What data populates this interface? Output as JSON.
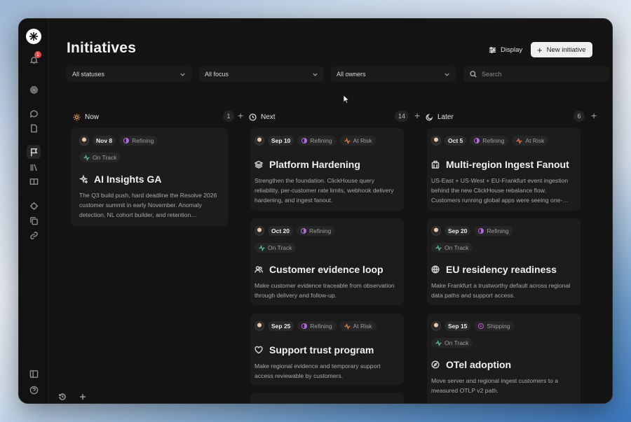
{
  "page": {
    "title": "Initiatives"
  },
  "toolbar": {
    "display_label": "Display",
    "new_label": "New initiative"
  },
  "notifications": {
    "count": "1"
  },
  "filters": {
    "status": "All statuses",
    "focus": "All focus",
    "owners": "All owners",
    "search_placeholder": "Search"
  },
  "columns": [
    {
      "name": "Now",
      "count": "1",
      "icon": "sun-icon"
    },
    {
      "name": "Next",
      "count": "14",
      "icon": "clock-icon"
    },
    {
      "name": "Later",
      "count": "6",
      "icon": "moon-icon"
    }
  ],
  "cards": {
    "now": [
      {
        "date": "Nov 8",
        "status": "Refining",
        "health": "On Track",
        "title": "AI Insights GA",
        "icon": "sparkles-icon",
        "desc": "The Q3 build push, hard deadline the Resolve 2026 customer summit in early November. Anomaly detection, NL cohort builder, and retention…"
      }
    ],
    "next": [
      {
        "date": "Sep 10",
        "status": "Refining",
        "risk": "At Risk",
        "title": "Platform Hardening",
        "icon": "layers-icon",
        "desc": "Strengthen the foundation. ClickHouse query reliability, per-customer rate limits, webhook delivery hardening, and ingest fanout."
      },
      {
        "date": "Oct 20",
        "status": "Refining",
        "health": "On Track",
        "title": "Customer evidence loop",
        "icon": "users-icon",
        "desc": "Make customer evidence traceable from observation through delivery and follow-up."
      },
      {
        "date": "Sep 25",
        "status": "Refining",
        "risk": "At Risk",
        "title": "Support trust program",
        "icon": "heart-icon",
        "desc": "Make regional evidence and temporary support access reviewable by customers."
      }
    ],
    "later": [
      {
        "date": "Oct 5",
        "status": "Refining",
        "risk": "At Risk",
        "title": "Multi-region Ingest Fanout",
        "icon": "building-icon",
        "desc": "US-East + US-West + EU-Frankfurt event ingestion behind the new ClickHouse rebalance flow. Customers running global apps were seeing one-…"
      },
      {
        "date": "Sep 20",
        "status": "Refining",
        "health": "On Track",
        "title": "EU residency readiness",
        "icon": "globe-icon",
        "desc": "Make Frankfurt a trustworthy default across regional data paths and support access."
      },
      {
        "date": "Sep 15",
        "status": "Shipping",
        "health": "On Track",
        "title": "OTel adoption",
        "icon": "compass-icon",
        "desc": "Move server and regional ingest customers to a measured OTLP v2 path."
      }
    ]
  },
  "colors": {
    "refining": "#b36bdc",
    "at_risk": "#e0784a",
    "on_track": "#4cc38a",
    "now_icon": "#f0a04b"
  }
}
